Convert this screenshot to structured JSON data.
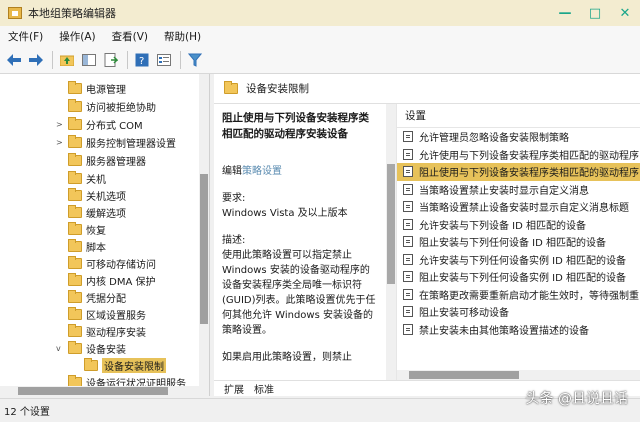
{
  "window": {
    "title": "本地组策略编辑器",
    "controls": [
      "minimize",
      "maximize",
      "close"
    ]
  },
  "menu": [
    "文件(F)",
    "操作(A)",
    "查看(V)",
    "帮助(H)"
  ],
  "toolbar_icons": [
    "back-icon",
    "forward-icon",
    "up-folder-icon",
    "show-tree-icon",
    "export-list-icon",
    "help-icon",
    "properties-icon",
    "filter-icon"
  ],
  "tree": {
    "items": [
      {
        "label": "电源管理",
        "chevron": ""
      },
      {
        "label": "访问被拒绝协助",
        "chevron": ""
      },
      {
        "label": "分布式 COM",
        "chevron": ">"
      },
      {
        "label": "服务控制管理器设置",
        "chevron": ">"
      },
      {
        "label": "服务器管理器",
        "chevron": ""
      },
      {
        "label": "关机",
        "chevron": ""
      },
      {
        "label": "关机选项",
        "chevron": ""
      },
      {
        "label": "缓解选项",
        "chevron": ""
      },
      {
        "label": "恢复",
        "chevron": ""
      },
      {
        "label": "脚本",
        "chevron": ""
      },
      {
        "label": "可移动存储访问",
        "chevron": ""
      },
      {
        "label": "内核 DMA 保护",
        "chevron": ""
      },
      {
        "label": "凭据分配",
        "chevron": ""
      },
      {
        "label": "区域设置服务",
        "chevron": ""
      },
      {
        "label": "驱动程序安装",
        "chevron": ""
      },
      {
        "label": "设备安装",
        "chevron": "v"
      },
      {
        "label": "设备安装限制",
        "chevron": "",
        "selected": true
      },
      {
        "label": "设备运行状况证明服务",
        "chevron": ""
      }
    ]
  },
  "header": {
    "title": "设备安装限制"
  },
  "description": {
    "title": "阻止使用与下列设备安装程序类相匹配的驱动程序安装设备",
    "edit_prefix": "编辑",
    "edit_link": "策略设置",
    "requirement_label": "要求:",
    "requirement_value": "Windows Vista 及以上版本",
    "desc_label": "描述:",
    "desc_text": "使用此策略设置可以指定禁止 Windows 安装的设备驱动程序的设备安装程序类全局唯一标识符(GUID)列表。此策略设置优先于任何其他允许 Windows 安装设备的策略设置。",
    "desc_more": "如果启用此策略设置，则禁止"
  },
  "settings": {
    "header": "设置",
    "items": [
      {
        "label": "允许管理员忽略设备安装限制策略"
      },
      {
        "label": "允许使用与下列设备安装程序类相匹配的驱动程序"
      },
      {
        "label": "阻止使用与下列设备安装程序类相匹配的驱动程序",
        "selected": true
      },
      {
        "label": "当策略设置禁止安装时显示自定义消息"
      },
      {
        "label": "当策略设置禁止设备安装时显示自定义消息标题"
      },
      {
        "label": "允许安装与下列设备 ID 相匹配的设备"
      },
      {
        "label": "阻止安装与下列任何设备 ID 相匹配的设备"
      },
      {
        "label": "允许安装与下列任何设备实例 ID 相匹配的设备"
      },
      {
        "label": "阻止安装与下列任何设备实例 ID 相匹配的设备"
      },
      {
        "label": "在策略更改需要重新启动才能生效时，等待强制重"
      },
      {
        "label": "阻止安装可移动设备"
      },
      {
        "label": "禁止安装未由其他策略设置描述的设备"
      }
    ]
  },
  "tabs": [
    "扩展",
    "标准"
  ],
  "status": {
    "text": "12 个设置"
  },
  "watermark": "头条 @且说且话",
  "colors": {
    "selection": "#e7c25a",
    "titlebar": "#f3ecd0",
    "window_controls": "#1aa68a",
    "link": "#5a8bb0"
  }
}
